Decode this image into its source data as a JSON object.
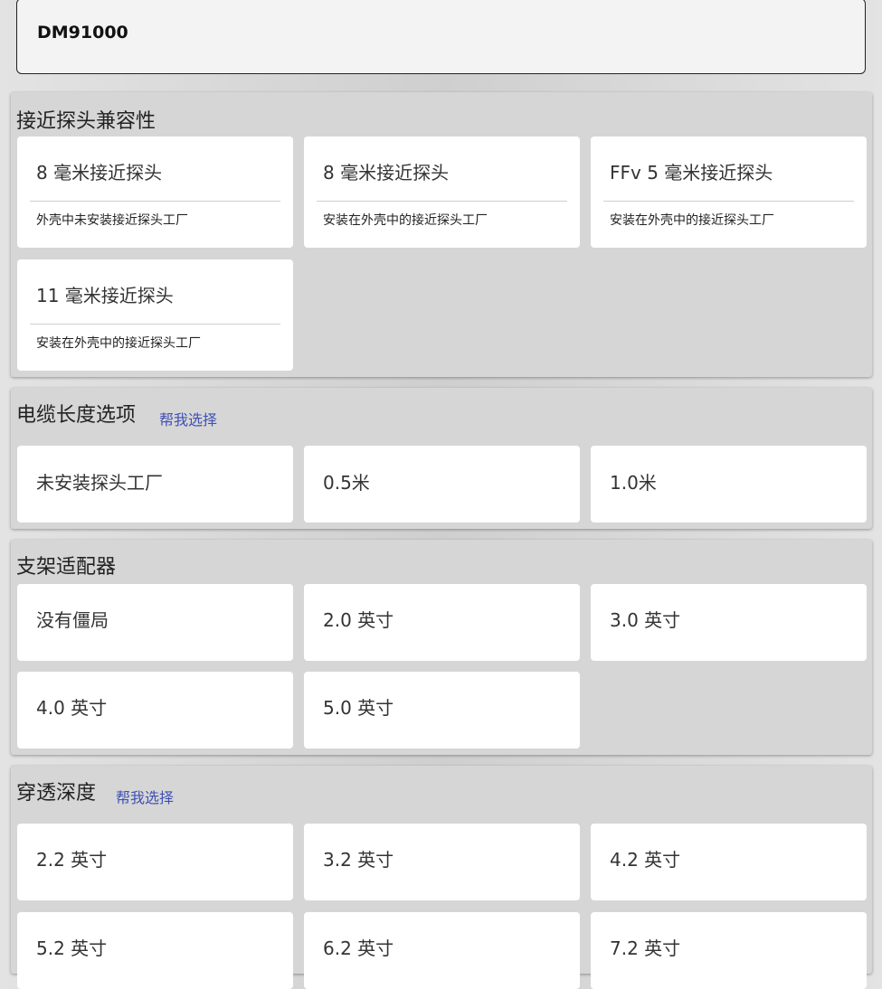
{
  "product": {
    "model": "DM91000"
  },
  "probe_section": {
    "title": "接近探头兼容性",
    "options": [
      {
        "label": "8 毫米接近探头",
        "sub": "外壳中未安装接近探头工厂"
      },
      {
        "label": "8 毫米接近探头",
        "sub": "安装在外壳中的接近探头工厂"
      },
      {
        "label": "FFv 5 毫米接近探头",
        "sub": "安装在外壳中的接近探头工厂"
      },
      {
        "label": "11 毫米接近探头",
        "sub": "安装在外壳中的接近探头工厂"
      }
    ]
  },
  "cable_section": {
    "title": "电缆长度选项",
    "help": "帮我选择",
    "options": [
      {
        "label": "未安装探头工厂"
      },
      {
        "label": "0.5米"
      },
      {
        "label": "1.0米"
      }
    ]
  },
  "bracket_section": {
    "title": "支架适配器",
    "options": [
      {
        "label": "没有僵局"
      },
      {
        "label": "2.0 英寸"
      },
      {
        "label": "3.0 英寸"
      },
      {
        "label": "4.0 英寸"
      },
      {
        "label": "5.0 英寸"
      }
    ]
  },
  "depth_section": {
    "title": "穿透深度",
    "help": "帮我选择",
    "options": [
      {
        "label": "2.2 英寸"
      },
      {
        "label": "3.2 英寸"
      },
      {
        "label": "4.2 英寸"
      },
      {
        "label": "5.2 英寸"
      },
      {
        "label": "6.2 英寸"
      },
      {
        "label": "7.2 英寸"
      }
    ]
  }
}
